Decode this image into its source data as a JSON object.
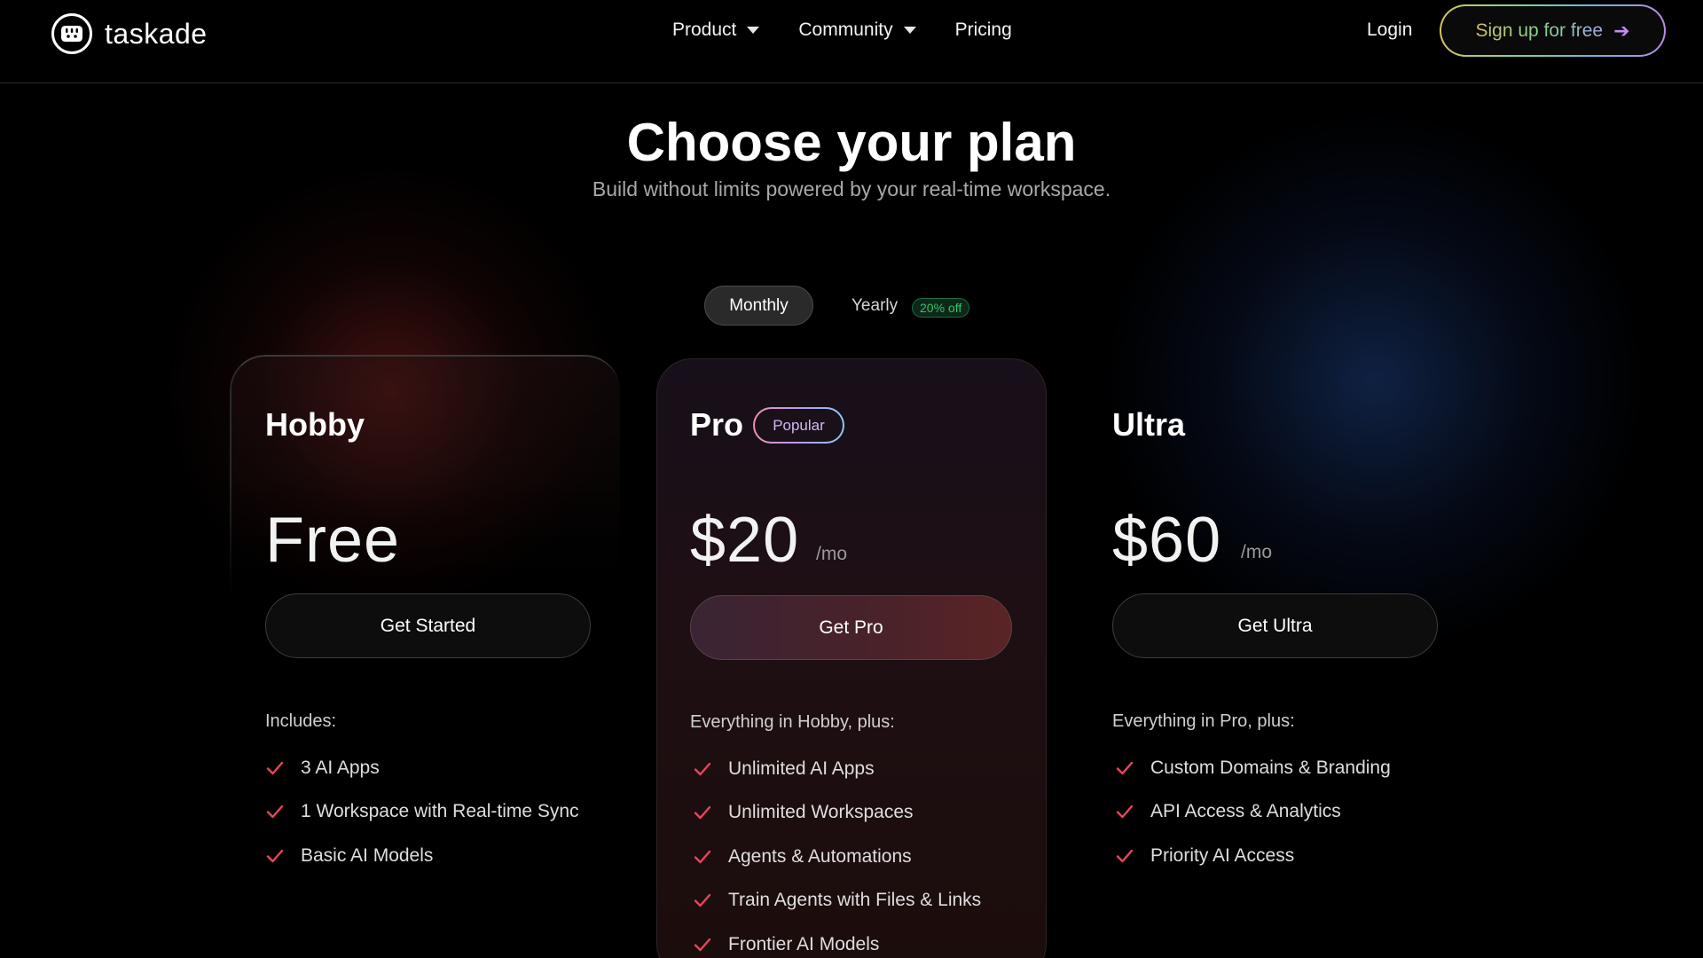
{
  "brand": {
    "name": "taskade"
  },
  "nav": {
    "items": [
      {
        "label": "Product",
        "has_dropdown": true
      },
      {
        "label": "Community",
        "has_dropdown": true
      },
      {
        "label": "Pricing",
        "has_dropdown": false
      }
    ],
    "login": "Login",
    "signup": "Sign up for free"
  },
  "hero": {
    "title": "Choose your plan",
    "subtitle": "Build without limits powered by your real-time workspace."
  },
  "billing": {
    "monthly": "Monthly",
    "yearly": "Yearly",
    "yearly_badge": "20% off",
    "selected": "Monthly"
  },
  "plans": [
    {
      "name": "Hobby",
      "price": "Free",
      "per": "",
      "cta": "Get Started",
      "includes": "Includes:",
      "features": [
        "3 AI Apps",
        "1 Workspace with Real-time Sync",
        "Basic AI Models"
      ]
    },
    {
      "name": "Pro",
      "badge": "Popular",
      "price": "$20",
      "per": "/mo",
      "cta": "Get Pro",
      "includes": "Everything in Hobby, plus:",
      "features": [
        "Unlimited AI Apps",
        "Unlimited Workspaces",
        "Agents & Automations",
        "Train Agents with Files & Links",
        "Frontier AI Models"
      ]
    },
    {
      "name": "Ultra",
      "price": "$60",
      "per": "/mo",
      "cta": "Get Ultra",
      "includes": "Everything in Pro, plus:",
      "features": [
        "Custom Domains & Branding",
        "API Access & Analytics",
        "Priority AI Access"
      ]
    }
  ],
  "colors": {
    "background": "#000000",
    "check": "#e8455a",
    "discount": "#34c16b"
  },
  "icons": {
    "logo": "taskade-logo-icon",
    "caret": "chevron-down-icon",
    "arrow": "arrow-right-icon",
    "check": "check-icon"
  }
}
